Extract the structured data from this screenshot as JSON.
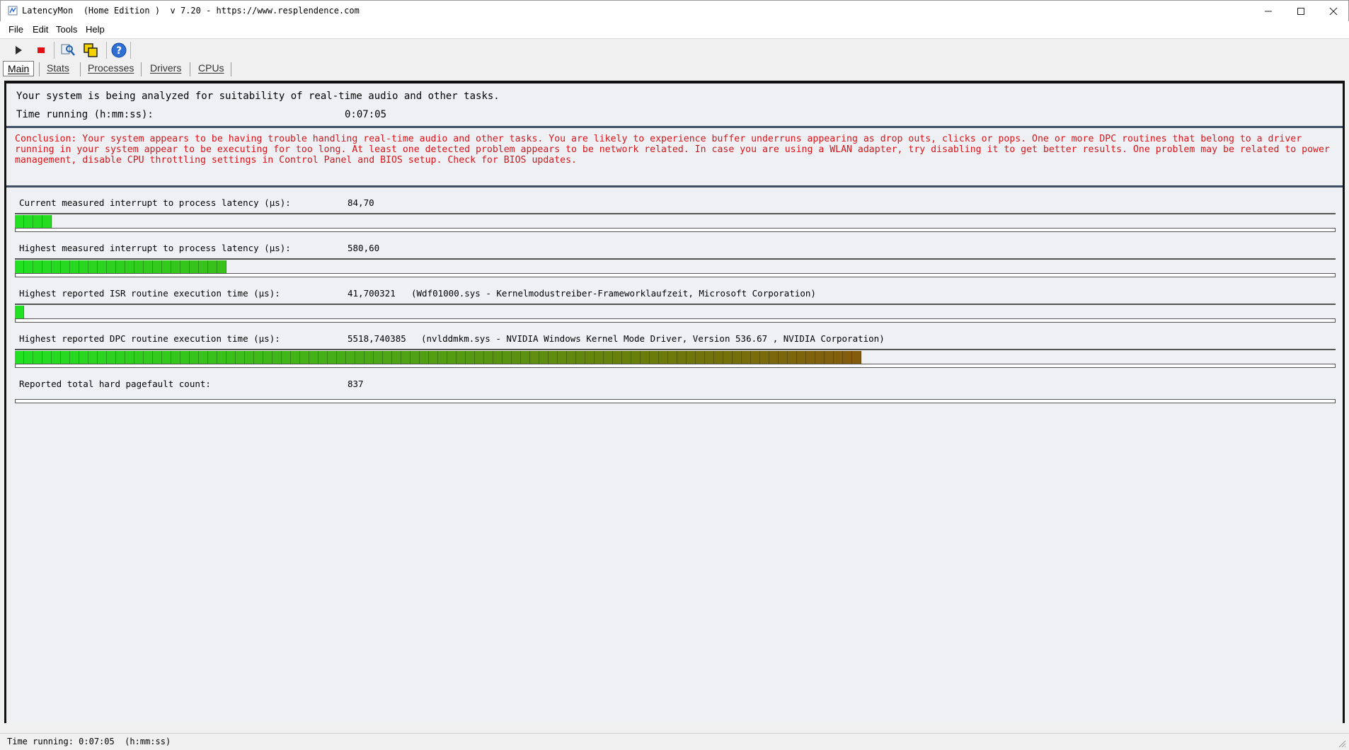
{
  "window": {
    "title": "LatencyMon  (Home Edition )  v 7.20 - https://www.resplendence.com"
  },
  "menu": {
    "file": "File",
    "edit": "Edit",
    "tools": "Tools",
    "help": "Help"
  },
  "tabs": [
    {
      "label": "Main"
    },
    {
      "label": "Stats"
    },
    {
      "label": "Processes"
    },
    {
      "label": "Drivers"
    },
    {
      "label": "CPUs"
    }
  ],
  "main": {
    "analyze_text": "Your system is being analyzed for suitability of real-time audio and other tasks.",
    "time_label": "Time running (h:mm:ss):",
    "time_value": "0:07:05",
    "conclusion": "Conclusion: Your system appears to be having trouble handling real-time audio and other tasks. You are likely to experience buffer underruns appearing as drop outs, clicks or pops. One or more DPC routines that belong to a driver running in your system appear to be executing for too long. At least one detected problem appears to be network related. In case you are using a WLAN adapter, try disabling it to get better results. One problem may be related to power management, disable CPU throttling settings in Control Panel and BIOS setup. Check for BIOS updates.",
    "metrics": [
      {
        "label": "Current measured interrupt to process latency (µs):",
        "value": "84,70",
        "detail": "",
        "level": 0.025
      },
      {
        "label": "Highest measured interrupt to process latency (µs):",
        "value": "580,60",
        "detail": "",
        "level": 0.162
      },
      {
        "label": "Highest reported ISR routine execution time (µs):",
        "value": "41,700321",
        "detail": "(Wdf01000.sys - Kernelmodustreiber-Frameworklaufzeit, Microsoft Corporation)",
        "level": 0.008
      },
      {
        "label": "Highest reported DPC routine execution time (µs):",
        "value": "5518,740385",
        "detail": "(nvlddmkm.sys - NVIDIA Windows Kernel Mode Driver, Version 536.67 , NVIDIA Corporation)",
        "level": 0.642
      },
      {
        "label": "Reported total hard pagefault count:",
        "value": "837",
        "detail": "",
        "level": null
      }
    ]
  },
  "status": {
    "text": "Time running: 0:07:05  (h:mm:ss)"
  },
  "colors": {
    "conclusion_red": "#d8151b",
    "bar_green": "#22e022",
    "bar_red": "#c01010"
  }
}
